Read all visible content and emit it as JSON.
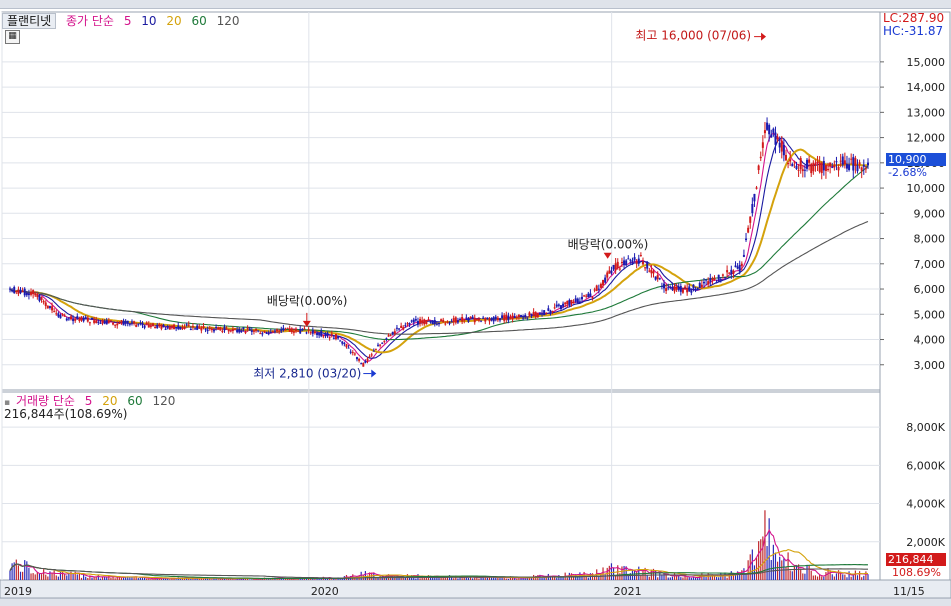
{
  "header": {
    "stock_name": "플랜티넷",
    "price_label": "종가 단순",
    "ma_periods": [
      "5",
      "10",
      "20",
      "60",
      "120"
    ],
    "ma_colors": [
      "#d4148c",
      "#1a1aa0",
      "#d4a20c",
      "#1f7a3a",
      "#555555"
    ],
    "lc": "LC:287.90",
    "hc": "HC:-31.87"
  },
  "volume_header": {
    "label": "거래량 단순",
    "ma_periods": [
      "5",
      "20",
      "60",
      "120"
    ],
    "ma_colors": [
      "#d4148c",
      "#d4a20c",
      "#1f7a3a",
      "#555555"
    ],
    "last_volume": "216,844주(108.69%)"
  },
  "current": {
    "price": "10,900",
    "change": "-2.68%",
    "volume": "216,844",
    "volume_pct": "108.69%"
  },
  "annotations": {
    "high": "최고 16,000 (07/06)",
    "low": "최저 2,810 (03/20)",
    "div1": "배당락(0.00%)",
    "div2": "배당락(0.00%)"
  },
  "x_labels": [
    "2019",
    "2020",
    "2021",
    "11/15"
  ],
  "chart_data": {
    "type": "line",
    "x": [
      "2019-01",
      "2019-02",
      "2019-03",
      "2019-04",
      "2019-05",
      "2019-06",
      "2019-07",
      "2019-08",
      "2019-09",
      "2019-10",
      "2019-11",
      "2019-12",
      "2020-01",
      "2020-02",
      "2020-03",
      "2020-04",
      "2020-05",
      "2020-06",
      "2020-07",
      "2020-08",
      "2020-09",
      "2020-10",
      "2020-11",
      "2020-12",
      "2021-01",
      "2021-02",
      "2021-03",
      "2021-04",
      "2021-05",
      "2021-06",
      "2021-07",
      "2021-08",
      "2021-09",
      "2021-10",
      "2021-11"
    ],
    "series": [
      {
        "name": "종가",
        "values": [
          6000,
          5800,
          4900,
          4800,
          4700,
          4600,
          4500,
          4500,
          4400,
          4400,
          4300,
          4400,
          4300,
          4100,
          3000,
          4200,
          4700,
          4700,
          4800,
          4800,
          4900,
          5000,
          5400,
          5700,
          6900,
          7200,
          6000,
          6000,
          6400,
          6900,
          12500,
          11000,
          10800,
          11000,
          10900
        ]
      }
    ],
    "y_ticks": [
      "3,000",
      "4,000",
      "5,000",
      "6,000",
      "7,000",
      "8,000",
      "9,000",
      "10,000",
      "11,000",
      "12,000",
      "13,000",
      "14,000",
      "15,000"
    ],
    "ylim": [
      2000,
      16500
    ],
    "volume": {
      "values": [
        900,
        500,
        300,
        250,
        150,
        120,
        100,
        100,
        90,
        80,
        80,
        90,
        100,
        120,
        300,
        250,
        200,
        180,
        150,
        120,
        130,
        180,
        250,
        300,
        600,
        500,
        250,
        200,
        250,
        350,
        2500,
        600,
        450,
        350,
        300
      ],
      "y_ticks": [
        "2,000K",
        "4,000K",
        "6,000K",
        "8,000K"
      ],
      "ylim": [
        0,
        9000
      ]
    },
    "grid": true
  }
}
